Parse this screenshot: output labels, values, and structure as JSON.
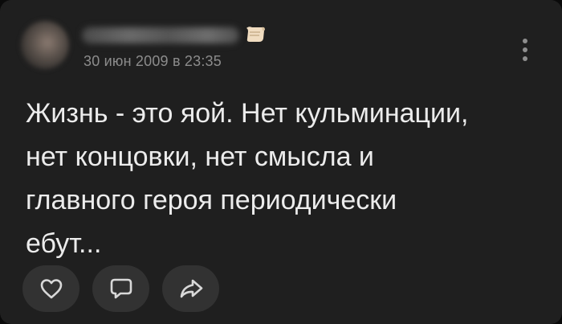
{
  "post": {
    "timestamp": "30 июн 2009 в 23:35",
    "text": "Жизнь - это яой. Нет кульминации,\nнет концовки, нет смысла и\nглавного героя периодически\nебут..."
  },
  "actions": [
    {
      "icon": "heart-icon"
    },
    {
      "icon": "comment-icon"
    },
    {
      "icon": "share-icon"
    }
  ],
  "colors": {
    "card_background": "#1f1f1f",
    "text": "#ececec",
    "muted_text": "#8c8c8c",
    "button_background": "#323232"
  }
}
